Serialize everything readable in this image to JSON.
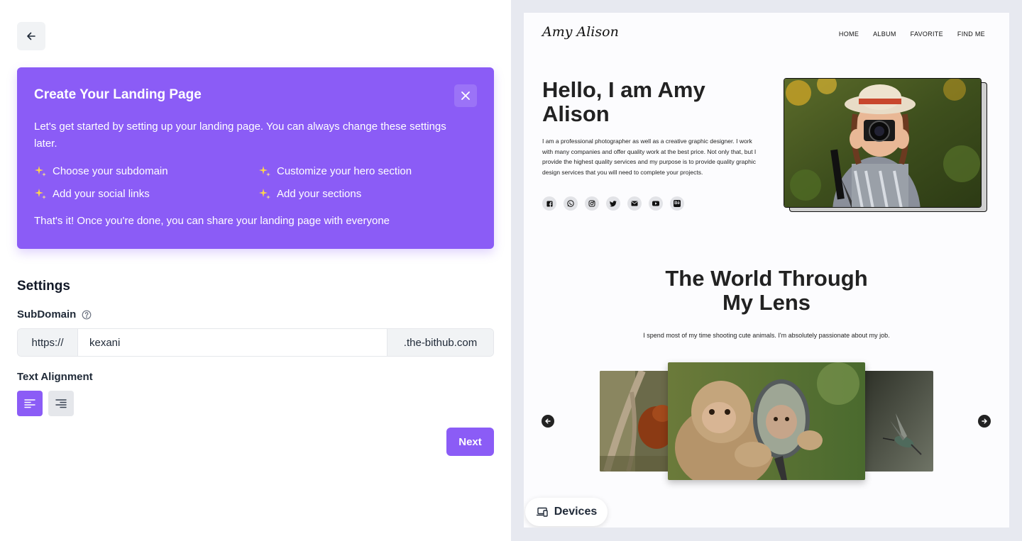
{
  "banner": {
    "title": "Create Your Landing Page",
    "description": "Let's get started by setting up your landing page. You can always change these settings later.",
    "steps": [
      "Choose your subdomain",
      "Customize your hero section",
      "Add your social links",
      "Add your sections"
    ],
    "footer": "That's it! Once you're done, you can share your landing page with everyone"
  },
  "settings": {
    "title": "Settings",
    "subdomain_label": "SubDomain",
    "prefix": "https://",
    "subdomain_value": "kexani",
    "suffix": ".the-bithub.com",
    "alignment_label": "Text Alignment",
    "next_label": "Next"
  },
  "preview": {
    "logo": "Amy Alison",
    "nav": [
      "HOME",
      "ALBUM",
      "FAVORITE",
      "FIND ME"
    ],
    "hero_title": "Hello, I am Amy Alison",
    "hero_text": "I am a professional photographer as well as a creative graphic designer. I work with many companies and offer quality work at the best price. Not only that, but I provide the highest quality services and my purpose is to provide quality graphic design services that you will need to complete your projects.",
    "socials": [
      "facebook-icon",
      "whatsapp-icon",
      "instagram-icon",
      "twitter-icon",
      "mail-icon",
      "youtube-icon",
      "behance-icon"
    ],
    "behance_text": "Bē",
    "section_title": "The World Through My Lens",
    "section_subtitle": "I spend most of my time shooting cute animals. I'm absolutely passionate about my job.",
    "devices_label": "Devices"
  },
  "colors": {
    "accent": "#8b5cf6",
    "sparkle": "#fcd34d"
  }
}
